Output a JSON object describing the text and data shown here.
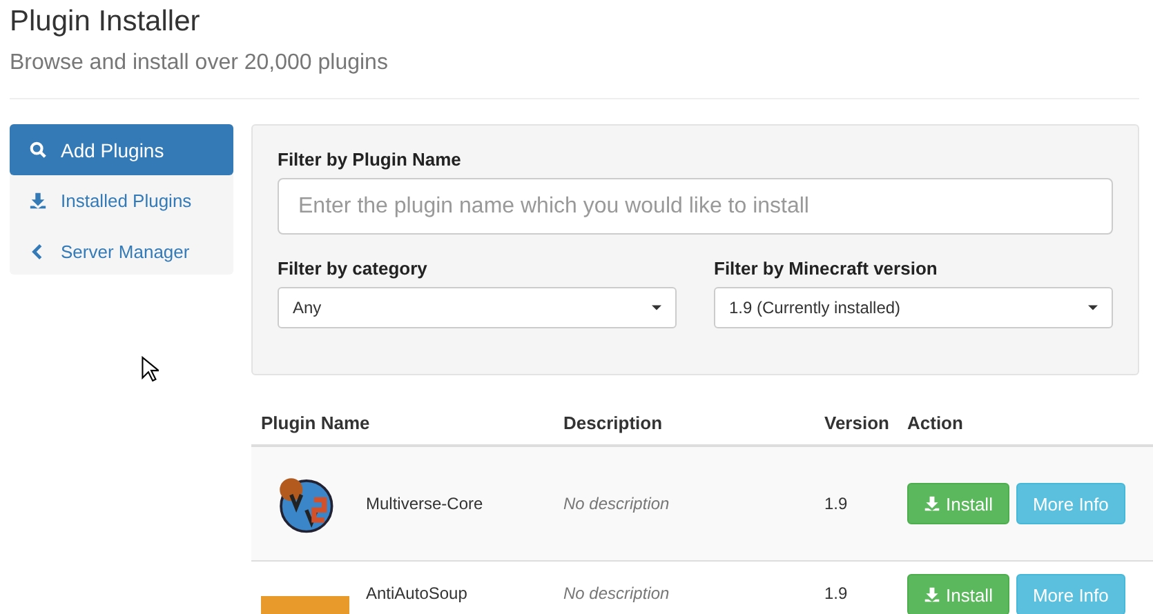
{
  "header": {
    "title": "Plugin Installer",
    "subtitle": "Browse and install over 20,000 plugins"
  },
  "sidebar": {
    "items": [
      {
        "label": "Add Plugins",
        "selected": true
      },
      {
        "label": "Installed Plugins",
        "selected": false
      },
      {
        "label": "Server Manager",
        "selected": false
      }
    ]
  },
  "filters": {
    "name": {
      "label": "Filter by Plugin Name",
      "placeholder": "Enter the plugin name which you would like to install"
    },
    "category": {
      "label": "Filter by category",
      "value": "Any"
    },
    "version": {
      "label": "Filter by Minecraft version",
      "value": "1.9 (Currently installed)"
    }
  },
  "table": {
    "columns": [
      "Plugin Name",
      "Description",
      "Version",
      "Action"
    ],
    "rows": [
      {
        "name": "Multiverse-Core",
        "description": "No description",
        "version": "1.9",
        "install": "Install",
        "info": "More Info"
      },
      {
        "name": "AntiAutoSoup",
        "description": "No description",
        "version": "1.9",
        "install": "Install",
        "info": "More Info"
      }
    ]
  }
}
